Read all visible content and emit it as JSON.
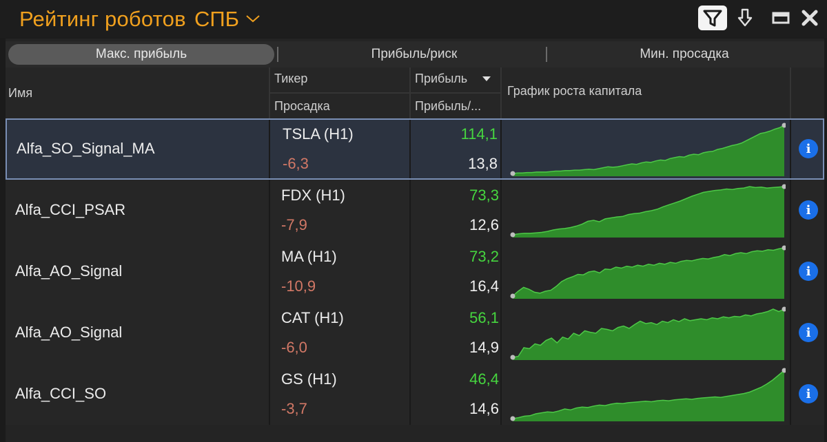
{
  "window": {
    "title": "Рейтинг роботов",
    "exchange": "СПБ",
    "icons": {
      "filter": "filter-icon",
      "download": "arrow-down-icon",
      "minimize": "minimize-icon",
      "close": "close-icon"
    }
  },
  "tabs": [
    {
      "label": "Макс. прибыль",
      "active": true
    },
    {
      "label": "Прибыль/риск",
      "active": false
    },
    {
      "label": "Мин. просадка",
      "active": false
    }
  ],
  "columns": {
    "name": "Имя",
    "ticker": "Тикер",
    "drawdown": "Просадка",
    "profit": "Прибыль",
    "profit_ratio": "Прибыль/...",
    "equity_chart": "График роста капитала"
  },
  "colors": {
    "accent": "#f0a01e",
    "profit": "#46d63f",
    "drawdown": "#d27866",
    "chart_fill": "#2f8d2b",
    "chart_line": "#4dc847",
    "info": "#1a6fe8",
    "selection_border": "#7a8fb5"
  },
  "rows": [
    {
      "name": "Alfa_SO_Signal_MA",
      "ticker": "TSLA (H1)",
      "profit": "114,1",
      "drawdown": "-6,3",
      "ratio": "13,8",
      "selected": true,
      "equity": [
        0,
        1,
        1,
        2,
        2,
        3,
        3,
        3,
        4,
        5,
        5,
        6,
        6,
        7,
        7,
        8,
        9,
        8,
        10,
        12,
        14,
        13,
        14,
        16,
        18,
        20,
        19,
        22,
        24,
        23,
        26,
        28,
        27,
        31,
        33,
        35,
        34,
        38,
        40,
        39,
        43,
        45,
        46,
        50,
        52,
        55,
        58,
        60,
        63,
        68,
        73,
        78,
        83,
        85,
        88,
        92,
        95,
        100
      ]
    },
    {
      "name": "Alfa_CCI_PSAR",
      "ticker": "FDX (H1)",
      "profit": "73,3",
      "drawdown": "-7,9",
      "ratio": "12,6",
      "selected": false,
      "equity": [
        0,
        2,
        3,
        3,
        4,
        5,
        7,
        10,
        12,
        13,
        15,
        18,
        22,
        28,
        30,
        27,
        33,
        35,
        37,
        38,
        42,
        44,
        45,
        48,
        50,
        53,
        58,
        62,
        66,
        70,
        75,
        80,
        84,
        88,
        90,
        92,
        93,
        95,
        94,
        96,
        97,
        100,
        98,
        99,
        97,
        98,
        99,
        100
      ]
    },
    {
      "name": "Alfa_AO_Signal",
      "ticker": "MA (H1)",
      "profit": "73,2",
      "drawdown": "-10,9",
      "ratio": "16,4",
      "selected": false,
      "equity": [
        0,
        10,
        18,
        14,
        8,
        6,
        10,
        12,
        20,
        30,
        36,
        40,
        45,
        44,
        50,
        52,
        48,
        56,
        55,
        60,
        58,
        62,
        60,
        64,
        62,
        66,
        64,
        68,
        66,
        70,
        68,
        72,
        74,
        73,
        76,
        78,
        77,
        80,
        82,
        86,
        84,
        88,
        90,
        88,
        92,
        94,
        93,
        96,
        95,
        98,
        100
      ]
    },
    {
      "name": "Alfa_AO_Signal",
      "ticker": "CAT (H1)",
      "profit": "56,1",
      "drawdown": "-6,0",
      "ratio": "14,9",
      "selected": false,
      "equity": [
        0,
        2,
        20,
        18,
        28,
        25,
        35,
        40,
        30,
        42,
        38,
        50,
        45,
        55,
        52,
        50,
        60,
        58,
        55,
        62,
        65,
        60,
        68,
        75,
        70,
        72,
        68,
        75,
        72,
        78,
        74,
        80,
        76,
        78,
        80,
        78,
        82,
        80,
        84,
        82,
        85,
        84,
        88,
        86,
        90,
        92,
        95,
        100,
        95,
        100
      ]
    },
    {
      "name": "Alfa_CCI_SO",
      "ticker": "GS (H1)",
      "profit": "46,4",
      "drawdown": "-3,7",
      "ratio": "14,6",
      "selected": false,
      "equity": [
        0,
        2,
        5,
        6,
        10,
        12,
        14,
        13,
        16,
        20,
        18,
        22,
        24,
        23,
        26,
        28,
        27,
        30,
        32,
        31,
        33,
        34,
        35,
        36,
        35,
        37,
        38,
        37,
        39,
        40,
        41,
        40,
        42,
        43,
        44,
        45,
        44,
        46,
        48,
        50,
        52,
        55,
        60,
        65,
        72,
        80,
        90,
        100
      ]
    }
  ]
}
